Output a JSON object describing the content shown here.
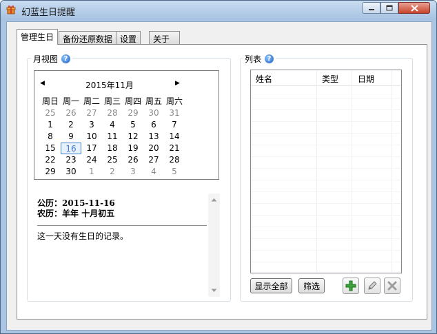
{
  "window": {
    "title": "幻蓝生日提醒"
  },
  "colors": {
    "accent": "#3d7bd1",
    "add": "#3aa43a"
  },
  "tabs": [
    {
      "label": "管理生日"
    },
    {
      "label": "备份还原数据"
    },
    {
      "label": "设置"
    },
    {
      "label": "关于"
    }
  ],
  "month_view": {
    "legend": "月视图",
    "help": "?",
    "month_label": "2015年11月",
    "weekdays": [
      "周日",
      "周一",
      "周二",
      "周三",
      "周四",
      "周五",
      "周六"
    ],
    "weeks": [
      [
        "25",
        "26",
        "27",
        "28",
        "29",
        "30",
        "31"
      ],
      [
        "1",
        "2",
        "3",
        "4",
        "5",
        "6",
        "7"
      ],
      [
        "8",
        "9",
        "10",
        "11",
        "12",
        "13",
        "14"
      ],
      [
        "15",
        "16",
        "17",
        "18",
        "19",
        "20",
        "21"
      ],
      [
        "22",
        "23",
        "24",
        "25",
        "26",
        "27",
        "28"
      ],
      [
        "29",
        "30",
        "1",
        "2",
        "3",
        "4",
        "5"
      ]
    ],
    "selected_day": "16",
    "solar_label": "公历：",
    "solar_value": "2015-11-16",
    "lunar_label": "农历：",
    "lunar_value": "羊年  十月初五",
    "message": "这一天没有生日的记录。"
  },
  "list": {
    "legend": "列表",
    "help": "?",
    "columns": [
      "姓名",
      "类型",
      "日期"
    ],
    "show_all_button": "显示全部",
    "filter_button": "筛选"
  }
}
